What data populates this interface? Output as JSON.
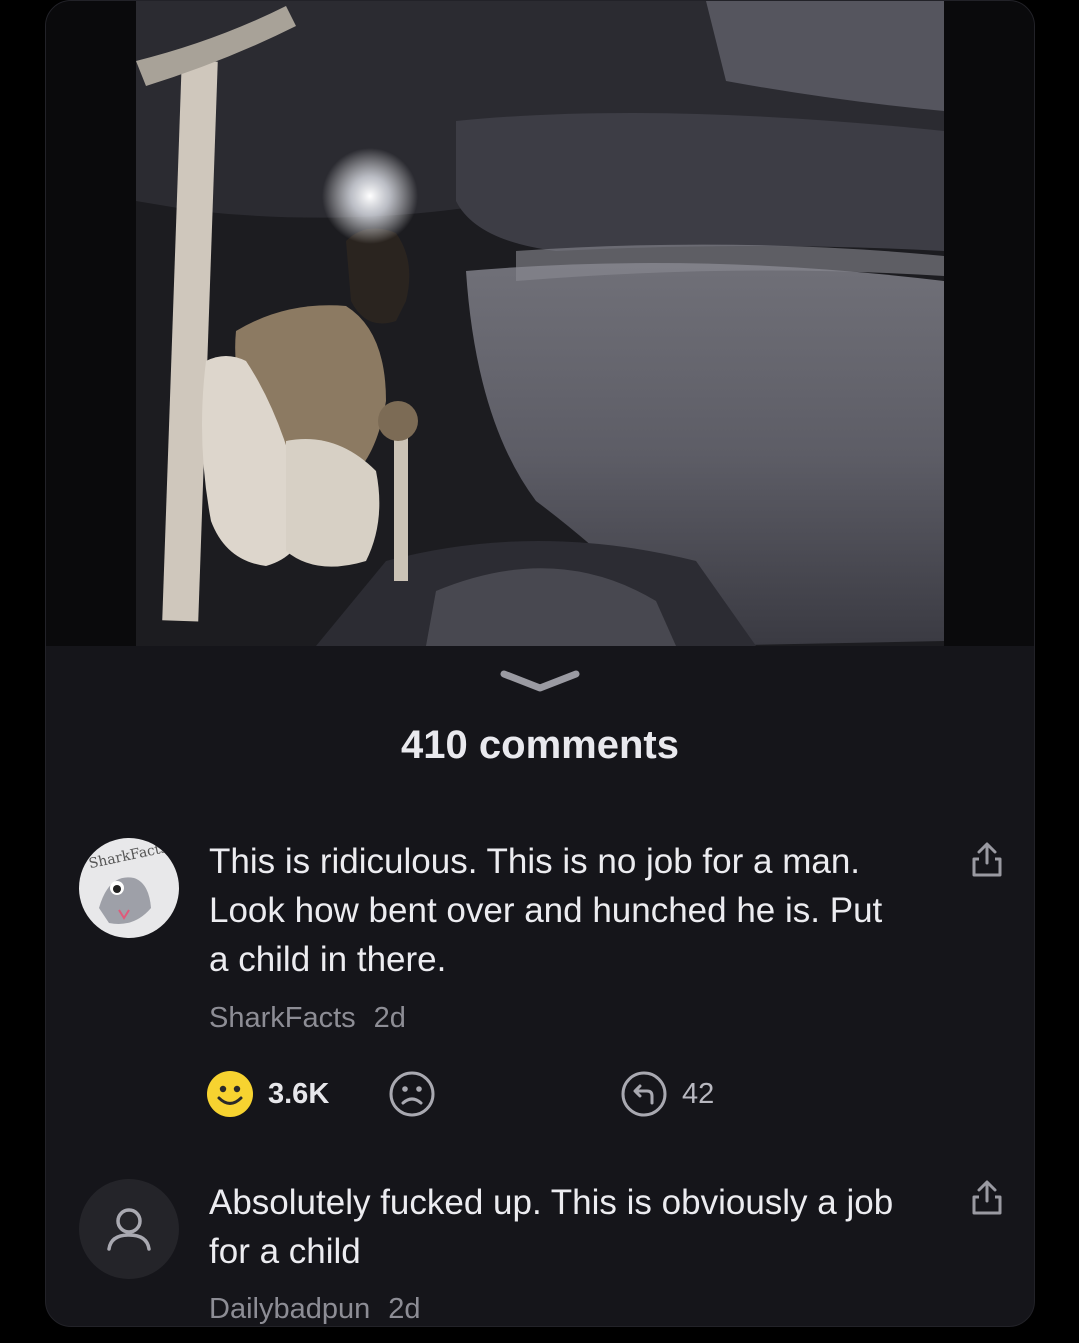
{
  "post": {
    "comments_label": "410 comments"
  },
  "comments": [
    {
      "text": "This is ridiculous. This is no job for a man. Look how bent over and hunched he is. Put a child in there.",
      "author": "SharkFacts",
      "age": "2d",
      "avatar_text": "SharkFacts",
      "reactions": {
        "smile": "3.6K",
        "replies": "42"
      }
    },
    {
      "text": "Absolutely fucked up. This is obviously a job for a child",
      "author": "Dailybadpun",
      "age": "2d"
    }
  ],
  "icons": {
    "collapse": "chevron-down-icon",
    "share": "share-icon",
    "smile": "smiley-face-icon",
    "frown": "frown-face-icon",
    "reply": "reply-arrow-icon",
    "user": "default-user-icon"
  },
  "colors": {
    "background": "#000000",
    "panel": "#15151a",
    "text": "#ececf0",
    "muted": "#8d8d95",
    "smiley": "#f7d330"
  }
}
